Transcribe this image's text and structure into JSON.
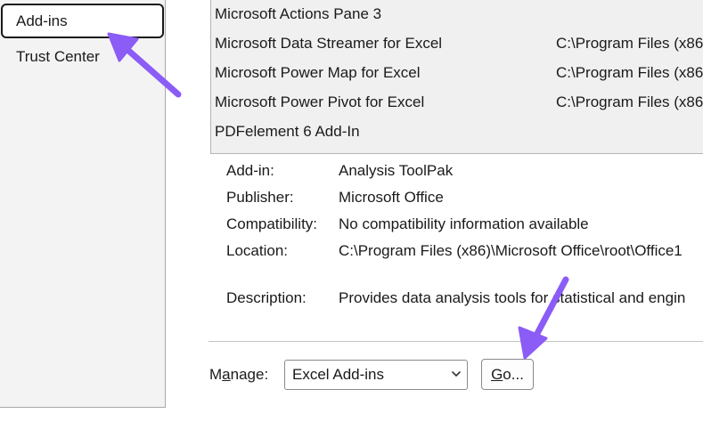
{
  "sidebar": {
    "items": [
      {
        "label": "Add-ins"
      },
      {
        "label": "Trust Center"
      }
    ]
  },
  "addins_list": {
    "rows": [
      {
        "name": "Microsoft Actions Pane 3",
        "location": ""
      },
      {
        "name": "Microsoft Data Streamer for Excel",
        "location": "C:\\Program Files (x86"
      },
      {
        "name": "Microsoft Power Map for Excel",
        "location": "C:\\Program Files (x86"
      },
      {
        "name": "Microsoft Power Pivot for Excel",
        "location": "C:\\Program Files (x86"
      },
      {
        "name": "PDFelement 6 Add-In",
        "location": ""
      }
    ]
  },
  "details": {
    "addin_label": "Add-in:",
    "addin_value": "Analysis ToolPak",
    "publisher_label": "Publisher:",
    "publisher_value": "Microsoft Office",
    "compat_label": "Compatibility:",
    "compat_value": "No compatibility information available",
    "location_label": "Location:",
    "location_value": "C:\\Program Files (x86)\\Microsoft Office\\root\\Office1",
    "description_label": "Description:",
    "description_value": "Provides data analysis tools for statistical and engin"
  },
  "manage": {
    "label_prefix": "M",
    "label_underlined": "a",
    "label_suffix": "nage:",
    "selected": "Excel Add-ins",
    "go_underlined": "G",
    "go_suffix": "o..."
  },
  "colors": {
    "arrow": "#8b5cf6"
  }
}
